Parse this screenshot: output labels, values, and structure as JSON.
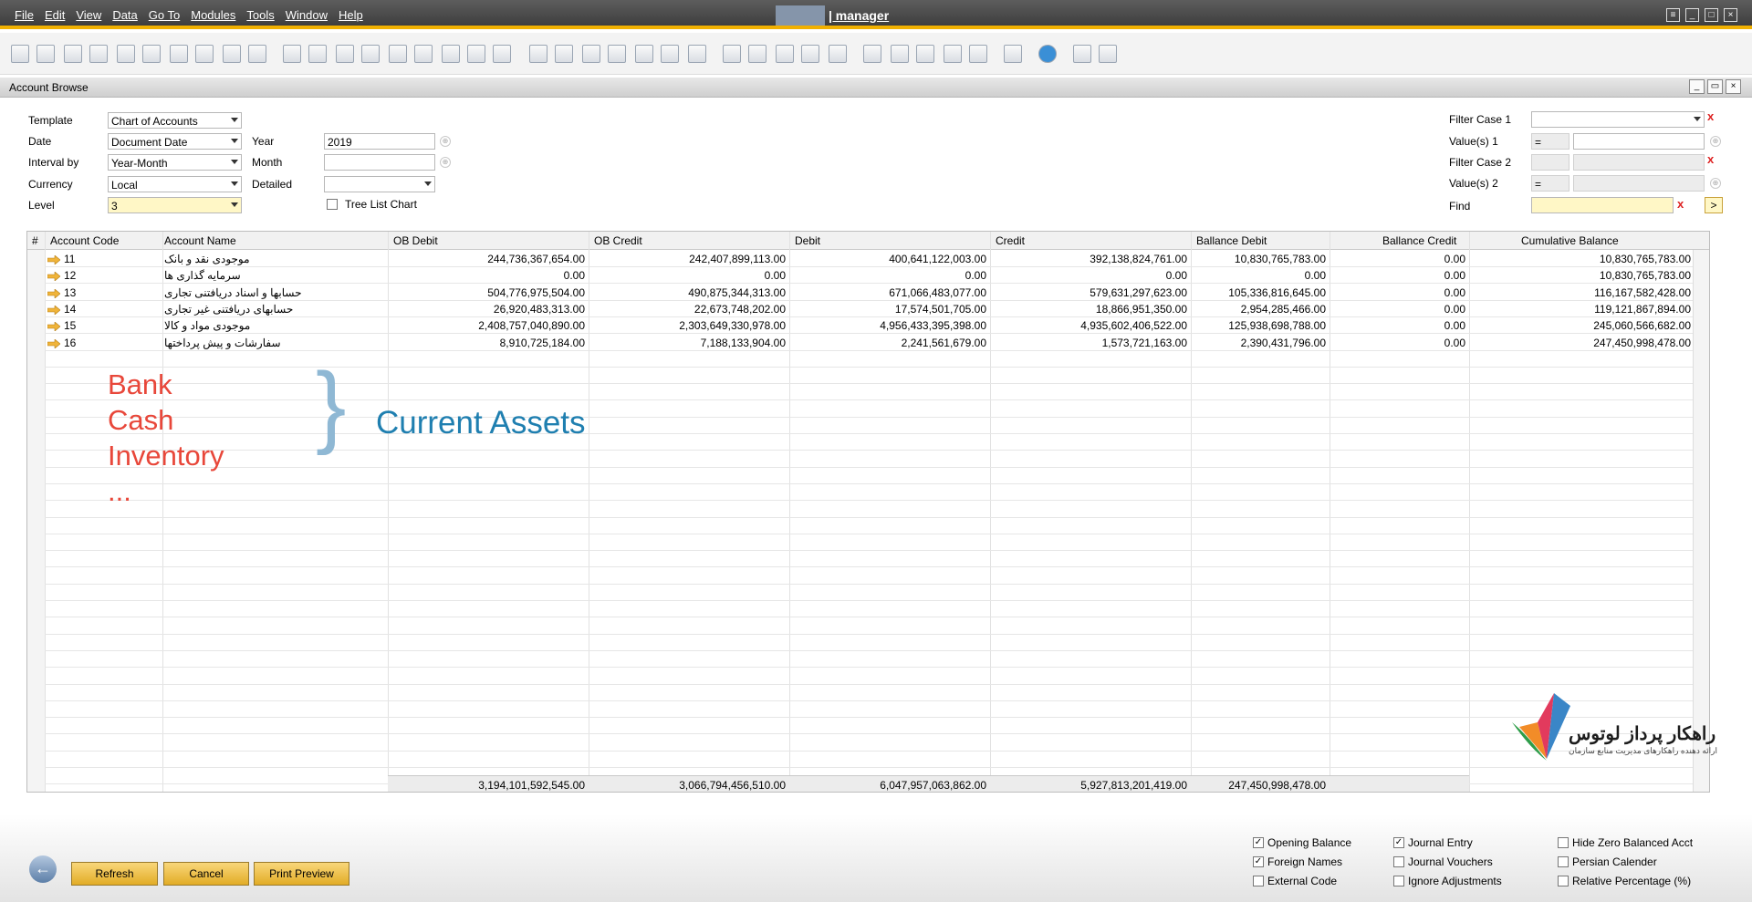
{
  "menu": {
    "items": [
      "File",
      "Edit",
      "View",
      "Data",
      "Go To",
      "Modules",
      "Tools",
      "Window",
      "Help"
    ],
    "user_label": "| manager"
  },
  "window": {
    "title": "Account Browse"
  },
  "form": {
    "template_label": "Template",
    "template_value": "Chart of Accounts",
    "date_label": "Date",
    "date_value": "Document Date",
    "interval_label": "Interval by",
    "interval_value": "Year-Month",
    "currency_label": "Currency",
    "currency_value": "Local",
    "level_label": "Level",
    "level_value": "3",
    "year_label": "Year",
    "year_value": "2019",
    "month_label": "Month",
    "month_value": "",
    "detailed_label": "Detailed",
    "detailed_value": "",
    "tree_label": "Tree List Chart",
    "filter1_label": "Filter Case 1",
    "values1_label": "Value(s) 1",
    "values1_op": "=",
    "filter2_label": "Filter Case 2",
    "values2_label": "Value(s) 2",
    "values2_op": "=",
    "find_label": "Find",
    "find_go": ">",
    "clear": "x"
  },
  "grid": {
    "columns": [
      "#",
      "Account Code",
      "Account Name",
      "OB Debit",
      "OB Credit",
      "Debit",
      "Credit",
      "Ballance Debit",
      "Ballance Credit",
      "Cumulative Balance"
    ],
    "rows": [
      {
        "code": "11",
        "name": "موجودی نقد و بانک",
        "ob_debit": "244,736,367,654.00",
        "ob_credit": "242,407,899,113.00",
        "debit": "400,641,122,003.00",
        "credit": "392,138,824,761.00",
        "bal_debit": "10,830,765,783.00",
        "bal_credit": "0.00",
        "cum": "10,830,765,783.00"
      },
      {
        "code": "12",
        "name": "سرمایه گذاری ها",
        "ob_debit": "0.00",
        "ob_credit": "0.00",
        "debit": "0.00",
        "credit": "0.00",
        "bal_debit": "0.00",
        "bal_credit": "0.00",
        "cum": "10,830,765,783.00"
      },
      {
        "code": "13",
        "name": "حسابها و اسناد دریافتنی تجاری",
        "ob_debit": "504,776,975,504.00",
        "ob_credit": "490,875,344,313.00",
        "debit": "671,066,483,077.00",
        "credit": "579,631,297,623.00",
        "bal_debit": "105,336,816,645.00",
        "bal_credit": "0.00",
        "cum": "116,167,582,428.00"
      },
      {
        "code": "14",
        "name": "حسابهای دریافتنی غیر تجاری",
        "ob_debit": "26,920,483,313.00",
        "ob_credit": "22,673,748,202.00",
        "debit": "17,574,501,705.00",
        "credit": "18,866,951,350.00",
        "bal_debit": "2,954,285,466.00",
        "bal_credit": "0.00",
        "cum": "119,121,867,894.00"
      },
      {
        "code": "15",
        "name": "موجودی مواد و کالا",
        "ob_debit": "2,408,757,040,890.00",
        "ob_credit": "2,303,649,330,978.00",
        "debit": "4,956,433,395,398.00",
        "credit": "4,935,602,406,522.00",
        "bal_debit": "125,938,698,788.00",
        "bal_credit": "0.00",
        "cum": "245,060,566,682.00"
      },
      {
        "code": "16",
        "name": "سفارشات و پیش پرداختها",
        "ob_debit": "8,910,725,184.00",
        "ob_credit": "7,188,133,904.00",
        "debit": "2,241,561,679.00",
        "credit": "1,573,721,163.00",
        "bal_debit": "2,390,431,796.00",
        "bal_credit": "0.00",
        "cum": "247,450,998,478.00"
      }
    ],
    "totals": {
      "ob_debit": "3,194,101,592,545.00",
      "ob_credit": "3,066,794,456,510.00",
      "debit": "6,047,957,063,862.00",
      "credit": "5,927,813,201,419.00",
      "bal_debit": "247,450,998,478.00"
    }
  },
  "annotation": {
    "items": [
      "Bank",
      "Cash",
      "Inventory",
      "..."
    ],
    "brace": "}",
    "label": "Current Assets",
    "item_color": "#e8473a",
    "label_color": "#1f7fb0"
  },
  "logo": {
    "name": "راهکار پرداز لوتوس",
    "tagline": "ارائه دهنده راهکارهای مدیریت منابع سازمان"
  },
  "options": [
    {
      "label": "Opening Balance",
      "checked": true
    },
    {
      "label": "Journal Entry",
      "checked": true
    },
    {
      "label": "Hide Zero Balanced Acct",
      "checked": false
    },
    {
      "label": "Foreign Names",
      "checked": true
    },
    {
      "label": "Journal Vouchers",
      "checked": false
    },
    {
      "label": "Persian Calender",
      "checked": false
    },
    {
      "label": "External Code",
      "checked": false
    },
    {
      "label": "Ignore Adjustments",
      "checked": false
    },
    {
      "label": "Relative Percentage (%)",
      "checked": false
    }
  ],
  "buttons": {
    "refresh": "Refresh",
    "cancel": "Cancel",
    "print_preview": "Print Preview"
  },
  "colors": {
    "accent": "#f0b000",
    "button": "#e8b640"
  }
}
